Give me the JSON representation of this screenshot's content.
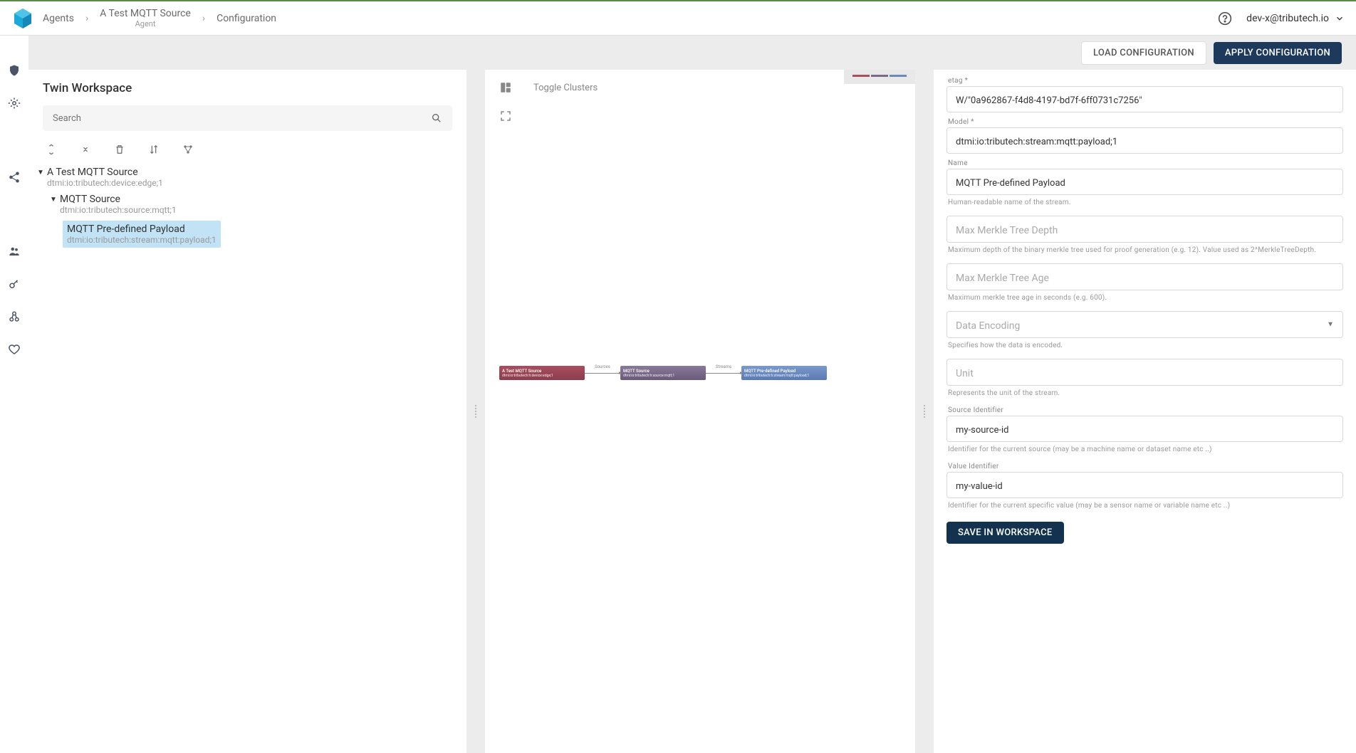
{
  "breadcrumbs": {
    "item1": "Agents",
    "item2": "A Test MQTT Source",
    "item2_sub": "Agent",
    "item3": "Configuration"
  },
  "header": {
    "user": "dev-x@tributech.io"
  },
  "actions": {
    "load": "LOAD CONFIGURATION",
    "apply": "APPLY CONFIGURATION",
    "save": "SAVE IN WORKSPACE"
  },
  "workspace": {
    "title": "Twin Workspace",
    "search_placeholder": "Search"
  },
  "tree": {
    "node1_label": "A Test MQTT Source",
    "node1_sub": "dtmi:io:tributech:device:edge;1",
    "node2_label": "MQTT Source",
    "node2_sub": "dtmi:io:tributech:source:mqtt;1",
    "node3_label": "MQTT Pre-defined Payload",
    "node3_sub": "dtmi:io:tributech:stream:mqtt:payload;1"
  },
  "center": {
    "toggle": "Toggle Clusters",
    "flow": {
      "n1_title": "A Test MQTT Source",
      "n1_sub": "dtmi:io:tributech:h:device:edge;1",
      "l1": "Sources",
      "n2_title": "MQTT Source",
      "n2_sub": "dtmi:io:tributech:h:source:mqtt;1",
      "l2": "Streams",
      "n3_title": "MQTT Pre-defined Payload",
      "n3_sub": "dtmi:io:tributech:h:stream:mqtt:payload;1"
    }
  },
  "form": {
    "etag_label": "etag *",
    "etag_value": "W/\"0a962867-f4d8-4197-bd7f-6ff0731c7256\"",
    "model_label": "Model *",
    "model_value": "dtmi:io:tributech:stream:mqtt:payload;1",
    "name_label": "Name",
    "name_value": "MQTT Pre-defined Payload",
    "name_help": "Human-readable name of the stream.",
    "maxdepth_placeholder": "Max Merkle Tree Depth",
    "maxdepth_help": "Maximum depth of the binary merkle tree used for proof generation (e.g. 12). Value used as 2^MerkleTreeDepth.",
    "maxage_placeholder": "Max Merkle Tree Age",
    "maxage_help": "Maximum merkle tree age in seconds (e.g. 600).",
    "encoding_placeholder": "Data Encoding",
    "encoding_help": "Specifies how the data is encoded.",
    "unit_placeholder": "Unit",
    "unit_help": "Represents the unit of the stream.",
    "srcid_label": "Source Identifier",
    "srcid_value": "my-source-id",
    "srcid_help": "Identifier for the current source (may be a machine name or dataset name etc ..)",
    "valid_label": "Value Identifier",
    "valid_value": "my-value-id",
    "valid_help": "Identifier for the current specific value (may be a sensor name or variable name etc ..)"
  }
}
